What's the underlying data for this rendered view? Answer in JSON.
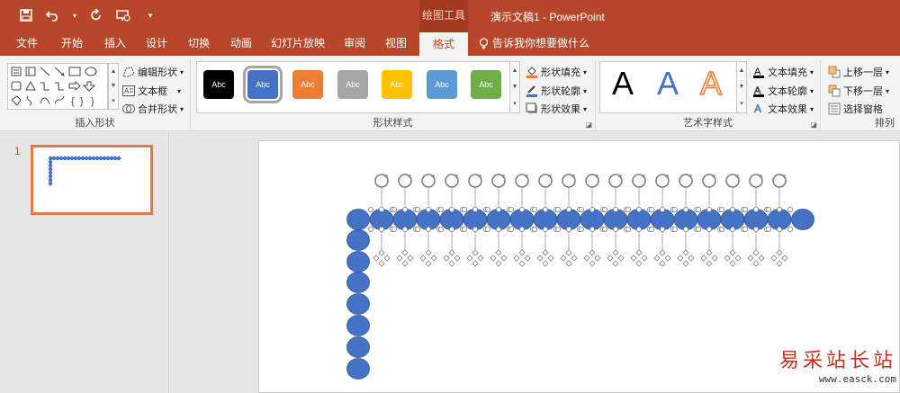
{
  "titlebar": {
    "contextual_tag": "绘图工具",
    "doc_title": "演示文稿1  -  PowerPoint",
    "qat": [
      "save-icon",
      "undo-icon",
      "redo-icon",
      "present-icon",
      "customize-icon"
    ]
  },
  "tabs": [
    "文件",
    "开始",
    "插入",
    "设计",
    "切换",
    "动画",
    "幻灯片放映",
    "审阅",
    "视图",
    "格式"
  ],
  "active_tab": "格式",
  "tell_me": "告诉我你想要做什么",
  "ribbon": {
    "insert_shapes": {
      "label": "插入形状",
      "edit_shape": "编辑形状",
      "text_box": "文本框",
      "merge_shapes": "合并形状"
    },
    "shape_styles": {
      "label": "形状样式",
      "sample_text": "Abc",
      "swatches": [
        "#000000",
        "#4472c4",
        "#ed7d31",
        "#a5a5a5",
        "#ffc000",
        "#5b9bd5",
        "#70ad47"
      ],
      "fill": "形状填充",
      "outline": "形状轮廓",
      "effects": "形状效果"
    },
    "wordart": {
      "label": "艺术字样式",
      "letters": [
        "A",
        "A",
        "A"
      ],
      "text_fill": "文本填充",
      "text_outline": "文本轮廓",
      "text_effects": "文本效果"
    },
    "arrange": {
      "label": "排列",
      "bring_forward": "上移一层",
      "send_backward": "下移一层",
      "selection_pane": "选择窗格"
    }
  },
  "thumbnails": {
    "slide_number": "1"
  },
  "watermark": {
    "line1": "易采站长站",
    "line2": "www.easck.com"
  },
  "colors": {
    "accent": "#b7472a",
    "shape_fill": "#4472c4"
  }
}
